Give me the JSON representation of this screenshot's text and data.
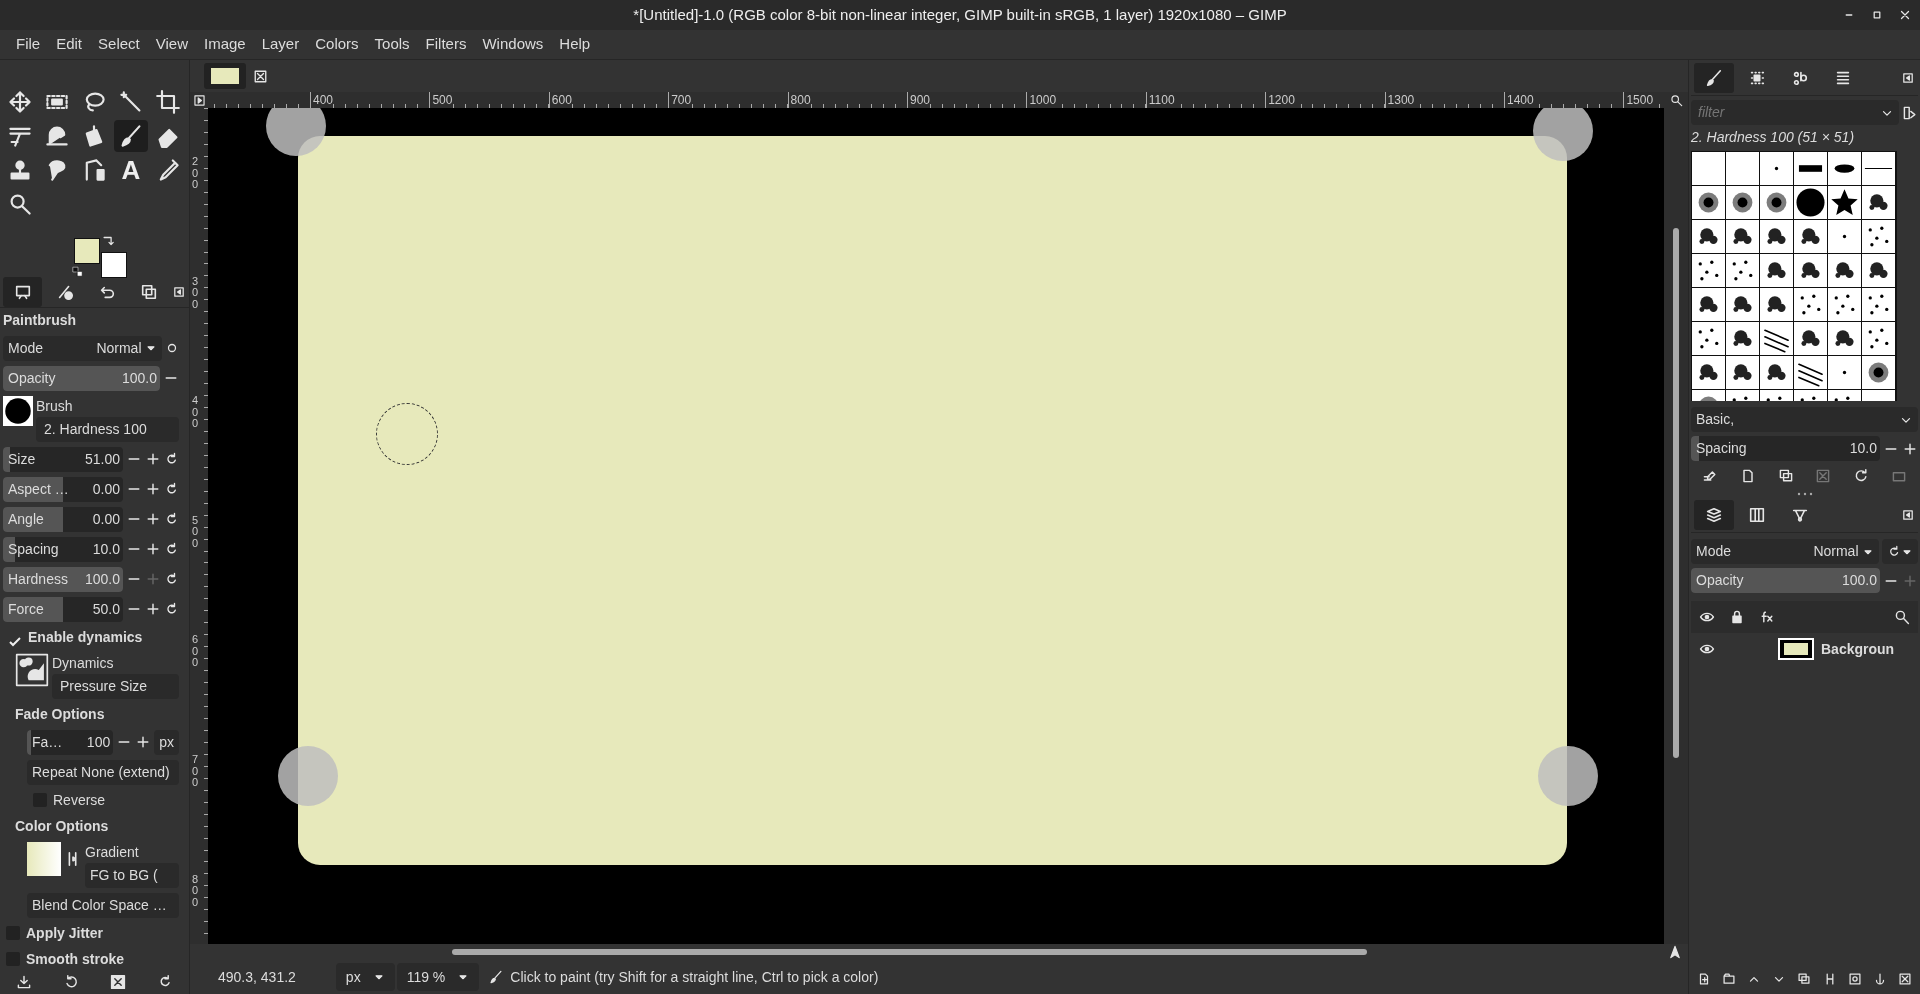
{
  "window": {
    "title": "*[Untitled]-1.0 (RGB color 8-bit non-linear integer, GIMP built-in sRGB, 1 layer) 1920x1080 – GIMP"
  },
  "menu": [
    "File",
    "Edit",
    "Select",
    "View",
    "Image",
    "Layer",
    "Colors",
    "Tools",
    "Filters",
    "Windows",
    "Help"
  ],
  "toolbox": {
    "tools": [
      {
        "kind": "move",
        "selected": false
      },
      {
        "kind": "rect-select",
        "selected": false
      },
      {
        "kind": "lasso",
        "selected": false
      },
      {
        "kind": "wand",
        "selected": false
      },
      {
        "kind": "crop",
        "selected": false
      },
      {
        "kind": "transform",
        "selected": false
      },
      {
        "kind": "warp",
        "selected": false
      },
      {
        "kind": "bucket",
        "selected": false
      },
      {
        "kind": "paintbrush",
        "selected": true
      },
      {
        "kind": "eraser",
        "selected": false
      },
      {
        "kind": "stamp",
        "selected": false
      },
      {
        "kind": "smudge",
        "selected": false
      },
      {
        "kind": "path",
        "selected": false
      },
      {
        "kind": "text",
        "label": "A",
        "selected": false
      },
      {
        "kind": "eyedropper",
        "selected": false
      },
      {
        "kind": "zoom",
        "selected": false
      }
    ],
    "swatches": [
      {
        "color": "#e7e9bb"
      },
      {
        "color": "#ffffff"
      }
    ]
  },
  "tool_options": {
    "title": "Paintbrush",
    "mode": {
      "label": "Mode",
      "value": "Normal"
    },
    "opacity": {
      "label": "Opacity",
      "value": "100.0",
      "level": 1.0
    },
    "brush": {
      "label": "Brush",
      "value": "2. Hardness 100"
    },
    "sliders": [
      {
        "label": "Size",
        "value": "51.00",
        "level": 0.06,
        "plus_disabled": false
      },
      {
        "label": "Aspect …",
        "value": "0.00",
        "level": 0.5,
        "plus_disabled": false
      },
      {
        "label": "Angle",
        "value": "0.00",
        "level": 0.5,
        "plus_disabled": false
      },
      {
        "label": "Spacing",
        "value": "10.0",
        "level": 0.1,
        "plus_disabled": false
      },
      {
        "label": "Hardness",
        "value": "100.0",
        "level": 1.0,
        "plus_disabled": true
      },
      {
        "label": "Force",
        "value": "50.0",
        "level": 0.5,
        "plus_disabled": false
      }
    ],
    "enable_dynamics": {
      "label": "Enable dynamics",
      "checked": true
    },
    "dynamics": {
      "label": "Dynamics",
      "value": "Pressure Size"
    },
    "fade_heading": "Fade Options",
    "fade_length": {
      "label": "Fa…",
      "value": "100",
      "level": 0.05,
      "unit": "px"
    },
    "repeat": "Repeat None (extend)",
    "reverse": {
      "label": "Reverse",
      "checked": false
    },
    "color_heading": "Color Options",
    "gradient": {
      "label": "Gradient",
      "value": "FG to BG ("
    },
    "blend": "Blend Color Space …",
    "apply_jitter": {
      "label": "Apply Jitter",
      "checked": false
    },
    "smooth_stroke": {
      "label": "Smooth stroke",
      "checked": false
    }
  },
  "rulers": {
    "horizontal": [
      "400",
      "500",
      "600",
      "700",
      "800",
      "900",
      "1000",
      "1100",
      "1200",
      "1300",
      "1400",
      "1500"
    ],
    "vertical": [
      "200",
      "300",
      "400",
      "500",
      "600",
      "700",
      "800"
    ]
  },
  "status_bar": {
    "coordinates": "490.3, 431.2",
    "unit": "px",
    "zoom": "119 %",
    "message": "Click to paint (try Shift for a straight line, Ctrl to pick a color)"
  },
  "brushes_panel": {
    "filter": {
      "placeholder": "filter"
    },
    "brush_name": "2. Hardness 100 (51 × 51)",
    "brushes": [
      {
        "kind": "blank"
      },
      {
        "kind": "blank"
      },
      {
        "kind": "dot"
      },
      {
        "kind": "bar"
      },
      {
        "kind": "ellipse"
      },
      {
        "kind": "line"
      },
      {
        "kind": "blur"
      },
      {
        "kind": "blur"
      },
      {
        "kind": "blur"
      },
      {
        "kind": "circle"
      },
      {
        "kind": "star"
      },
      {
        "kind": "splatter"
      },
      {
        "kind": "splatter"
      },
      {
        "kind": "splatter"
      },
      {
        "kind": "splatter"
      },
      {
        "kind": "splatter"
      },
      {
        "kind": "dot"
      },
      {
        "kind": "speckle"
      },
      {
        "kind": "speckle"
      },
      {
        "kind": "speckle"
      },
      {
        "kind": "splatter"
      },
      {
        "kind": "splatter"
      },
      {
        "kind": "splatter"
      },
      {
        "kind": "splatter"
      },
      {
        "kind": "splatter"
      },
      {
        "kind": "splatter"
      },
      {
        "kind": "splatter"
      },
      {
        "kind": "speckle"
      },
      {
        "kind": "speckle"
      },
      {
        "kind": "speckle"
      },
      {
        "kind": "speckle"
      },
      {
        "kind": "splatter"
      },
      {
        "kind": "lines"
      },
      {
        "kind": "splatter"
      },
      {
        "kind": "splatter"
      },
      {
        "kind": "speckle"
      },
      {
        "kind": "splatter"
      },
      {
        "kind": "splatter"
      },
      {
        "kind": "splatter"
      },
      {
        "kind": "lines"
      },
      {
        "kind": "dot"
      },
      {
        "kind": "blur"
      },
      {
        "kind": "blur"
      },
      {
        "kind": "speckle"
      },
      {
        "kind": "speckle"
      },
      {
        "kind": "speckle"
      },
      {
        "kind": "speckle"
      },
      {
        "kind": "blank"
      }
    ],
    "preset": "Basic,",
    "spacing": {
      "label": "Spacing",
      "value": "10.0",
      "level": 0.04
    }
  },
  "layers_panel": {
    "mode": {
      "label": "Mode",
      "value": "Normal"
    },
    "opacity": {
      "label": "Opacity",
      "value": "100.0",
      "level": 1.0
    },
    "layers": [
      {
        "name": "Backgroun",
        "visible": true
      }
    ]
  }
}
